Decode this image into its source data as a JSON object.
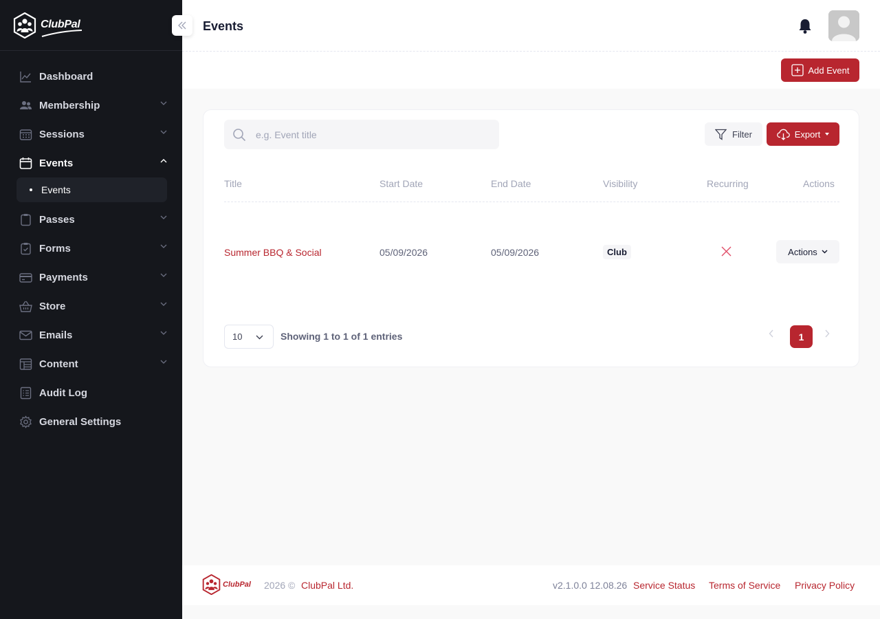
{
  "brand": {
    "name": "ClubPal"
  },
  "sidebar": {
    "items": [
      {
        "label": "Dashboard",
        "icon": "chart-line-icon",
        "has_chevron": false
      },
      {
        "label": "Membership",
        "icon": "users-icon",
        "has_chevron": true
      },
      {
        "label": "Sessions",
        "icon": "calendar-grid-icon",
        "has_chevron": true
      },
      {
        "label": "Events",
        "icon": "calendar-icon",
        "has_chevron": true,
        "expanded": true,
        "active": true
      },
      {
        "label": "Passes",
        "icon": "clipboard-icon",
        "has_chevron": true
      },
      {
        "label": "Forms",
        "icon": "clipboard-check-icon",
        "has_chevron": true
      },
      {
        "label": "Payments",
        "icon": "credit-card-icon",
        "has_chevron": true
      },
      {
        "label": "Store",
        "icon": "basket-icon",
        "has_chevron": true
      },
      {
        "label": "Emails",
        "icon": "envelope-icon",
        "has_chevron": true
      },
      {
        "label": "Content",
        "icon": "layout-icon",
        "has_chevron": true
      },
      {
        "label": "Audit Log",
        "icon": "list-icon",
        "has_chevron": false
      },
      {
        "label": "General Settings",
        "icon": "gear-icon",
        "has_chevron": false
      }
    ],
    "events_sub": [
      {
        "label": "Events",
        "active": true
      }
    ]
  },
  "header": {
    "title": "Events"
  },
  "toolbar": {
    "add_label": "Add Event"
  },
  "search": {
    "placeholder": "e.g. Event title",
    "value": ""
  },
  "filter_label": "Filter",
  "export_label": "Export",
  "table": {
    "columns": [
      "Title",
      "Start Date",
      "End Date",
      "Visibility",
      "Recurring",
      "Actions"
    ],
    "rows": [
      {
        "title": "Summer BBQ & Social",
        "start_date": "05/09/2026",
        "end_date": "05/09/2026",
        "visibility": "Club",
        "recurring": false,
        "actions_label": "Actions"
      }
    ]
  },
  "pagination": {
    "page_size": "10",
    "summary": "Showing 1 to 1 of 1 entries",
    "current_page": "1"
  },
  "footer": {
    "year": "2026 ©",
    "company": "ClubPal Ltd.",
    "version": "v2.1.0.0 12.08.26",
    "links": [
      "Service Status",
      "Terms of Service",
      "Privacy Policy"
    ]
  },
  "colors": {
    "accent": "#b8262f",
    "sidebar_bg": "#15171c",
    "page_bg": "#f9f9f9"
  }
}
